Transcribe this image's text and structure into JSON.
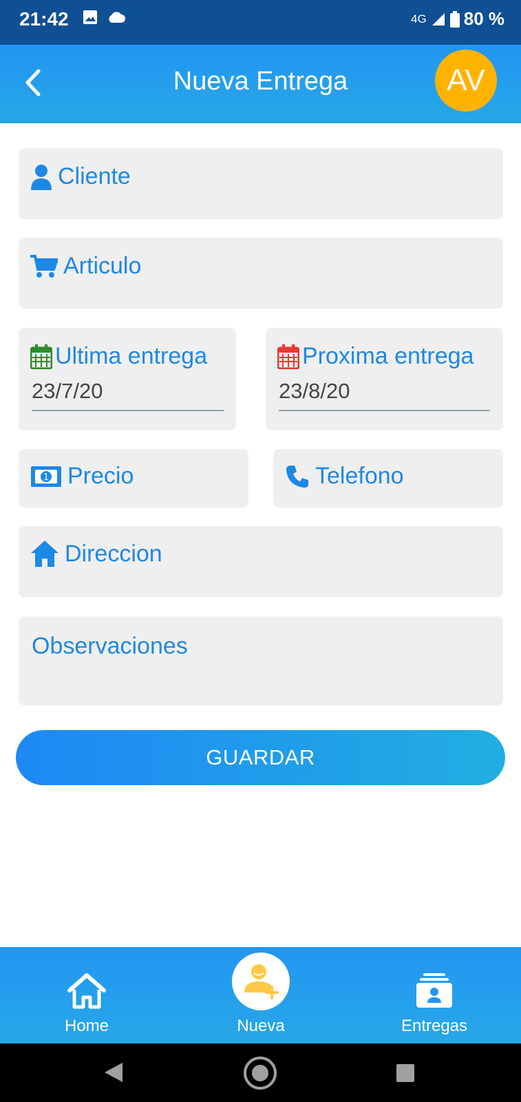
{
  "status_bar": {
    "time": "21:42",
    "network": "4G",
    "battery": "80 %"
  },
  "app_bar": {
    "title": "Nueva Entrega",
    "avatar_initials": "AV"
  },
  "form": {
    "cliente": {
      "label": "Cliente"
    },
    "articulo": {
      "label": "Articulo"
    },
    "ultima_entrega": {
      "label": "Ultima entrega",
      "value": "23/7/20"
    },
    "proxima_entrega": {
      "label": "Proxima entrega",
      "value": "23/8/20"
    },
    "precio": {
      "label": "Precio"
    },
    "telefono": {
      "label": "Telefono"
    },
    "direccion": {
      "label": "Direccion"
    },
    "observaciones": {
      "label": "Observaciones"
    }
  },
  "save_button": {
    "label": "GUARDAR"
  },
  "bottom_nav": {
    "items": [
      {
        "label": "Home",
        "icon": "home-icon"
      },
      {
        "label": "Nueva",
        "icon": "add-user-icon"
      },
      {
        "label": "Entregas",
        "icon": "entregas-icon"
      }
    ]
  },
  "colors": {
    "primary": "#1e88e5",
    "status_bar": "#0f4f93",
    "avatar": "#ffb300",
    "field_bg": "#efefef",
    "calendar_green": "#2e8b2e",
    "calendar_red": "#e53935"
  }
}
